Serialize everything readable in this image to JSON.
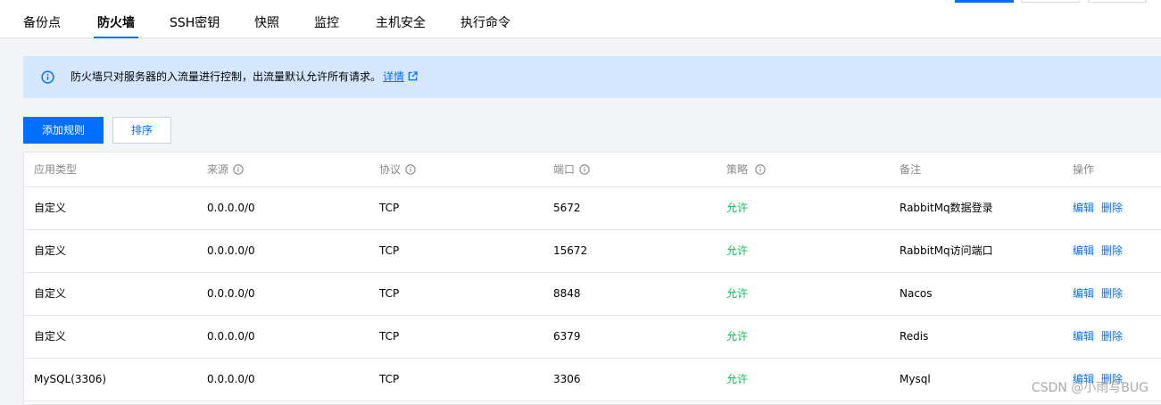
{
  "tabs": [
    {
      "label": "备份点"
    },
    {
      "label": "防火墙"
    },
    {
      "label": "SSH密钥"
    },
    {
      "label": "快照"
    },
    {
      "label": "监控"
    },
    {
      "label": "主机安全"
    },
    {
      "label": "执行命令"
    }
  ],
  "active_tab": "防火墙",
  "notice": {
    "text": "防火墙只对服务器的入流量进行控制，出流量默认允许所有请求。",
    "link": "详情"
  },
  "toolbar": {
    "add_rule_label": "添加规则",
    "sort_label": "排序"
  },
  "table": {
    "columns": [
      "应用类型",
      "来源",
      "协议",
      "端口",
      "策略",
      "备注",
      "操作"
    ],
    "rows": [
      {
        "type": "自定义",
        "source": "0.0.0.0/0",
        "protocol": "TCP",
        "port": "5672",
        "policy": "允许",
        "remark": "RabbitMq数据登录"
      },
      {
        "type": "自定义",
        "source": "0.0.0.0/0",
        "protocol": "TCP",
        "port": "15672",
        "policy": "允许",
        "remark": "RabbitMq访问端口"
      },
      {
        "type": "自定义",
        "source": "0.0.0.0/0",
        "protocol": "TCP",
        "port": "8848",
        "policy": "允许",
        "remark": "Nacos"
      },
      {
        "type": "自定义",
        "source": "0.0.0.0/0",
        "protocol": "TCP",
        "port": "6379",
        "policy": "允许",
        "remark": "Redis"
      },
      {
        "type": "MySQL(3306)",
        "source": "0.0.0.0/0",
        "protocol": "TCP",
        "port": "3306",
        "policy": "允许",
        "remark": "Mysql"
      }
    ],
    "edit_label": "编辑",
    "delete_label": "删除"
  },
  "watermark": "CSDN @小雨写BUG",
  "colors": {
    "accent": "#006eff",
    "allow": "#0abf5b",
    "notice_bg": "#d5e7ff"
  }
}
